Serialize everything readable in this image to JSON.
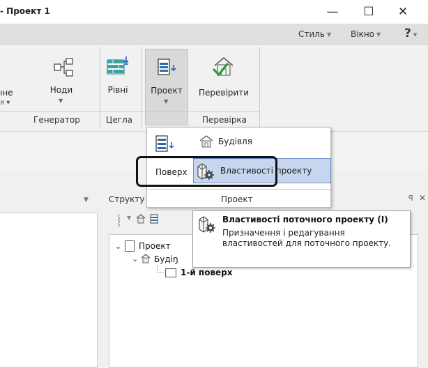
{
  "window": {
    "title": "- Проект 1",
    "minimize_glyph": "—",
    "maximize_glyph": "☐",
    "close_glyph": "✕"
  },
  "menu_right": {
    "style_label": "Стиль",
    "window_label": "Вікно",
    "help_glyph": "?"
  },
  "ribbon": {
    "left_cut_line1": "ıне",
    "left_cut_line2": "я ▾",
    "nodes_label": "Ноди",
    "levels_label": "Рівні",
    "project_label": "Проект",
    "check_label": "Перевірити",
    "groups": {
      "generator": "Генератор",
      "brick": "Цегла",
      "check": "Перевірка"
    }
  },
  "dropdown": {
    "building_label": "Будівля",
    "floor_label": "Поверх",
    "project_props_label": "Властивості проекту",
    "footer_label": "Проект"
  },
  "tooltip": {
    "title": "Властивості поточного проекту (I)",
    "description": "Призначення і редагування властивостей для поточного проекту."
  },
  "structure_panel": {
    "title": "Структу",
    "pin_glyph": "ꟼ",
    "close_glyph": "✕"
  },
  "tree": {
    "project": "Проект",
    "building": "Будіŋ",
    "floor": "1-й поверх"
  },
  "colors": {
    "highlight_bg": "#c7d6ee",
    "highlight_border": "#6b8fc6",
    "ribbon_bg": "#f1f1f1",
    "tabstrip_bg": "#dfdfdf"
  }
}
